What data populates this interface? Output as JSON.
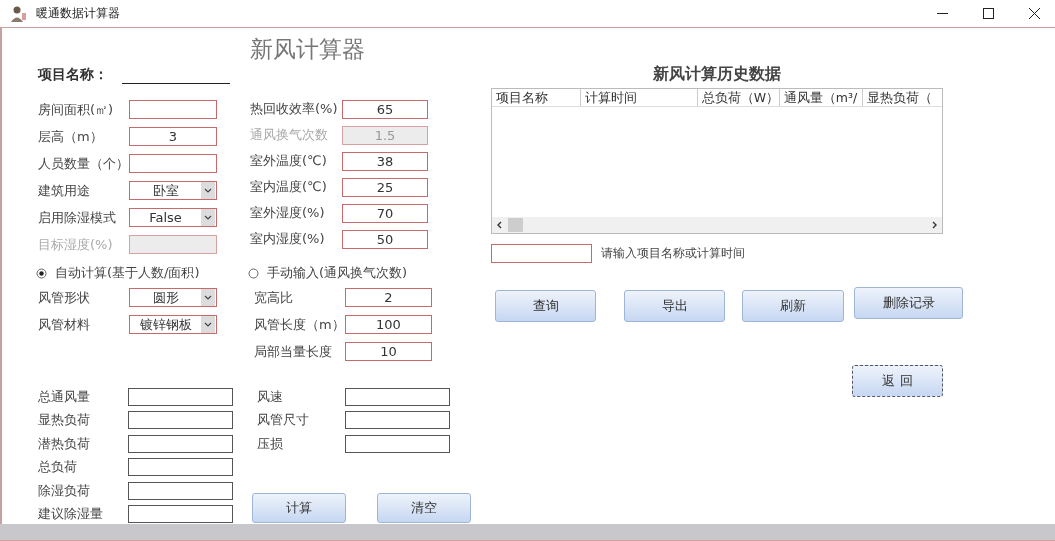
{
  "window": {
    "title": "暖通数据计算器"
  },
  "heading": "新风计算器",
  "project": {
    "label": "项目名称："
  },
  "inputs_left": [
    {
      "label": "房间面积(㎡)",
      "kind": "text",
      "disabled": false
    },
    {
      "label": "层高（m）",
      "kind": "text",
      "disabled": false,
      "value": "3"
    },
    {
      "label": "人员数量（个）",
      "kind": "text",
      "disabled": false
    },
    {
      "label": "建筑用途",
      "kind": "select",
      "disabled": false,
      "value": "卧室"
    },
    {
      "label": "启用除湿模式",
      "kind": "select",
      "disabled": false,
      "value": "False"
    },
    {
      "label": "目标湿度(%)",
      "kind": "text",
      "disabled": true
    }
  ],
  "inputs_right": [
    {
      "label": "热回收效率(%)",
      "kind": "text",
      "disabled": false,
      "value": "65"
    },
    {
      "label": "通风换气次数",
      "kind": "text",
      "disabled": true,
      "value": "1.5"
    },
    {
      "label": "室外温度(℃)",
      "kind": "text",
      "disabled": false,
      "value": "38"
    },
    {
      "label": "室内温度(℃)",
      "kind": "text",
      "disabled": false,
      "value": "25"
    },
    {
      "label": "室外湿度(%)",
      "kind": "text",
      "disabled": false,
      "value": "70"
    },
    {
      "label": "室内湿度(%)",
      "kind": "text",
      "disabled": false,
      "value": "50"
    }
  ],
  "modes": [
    {
      "label": "自动计算(基于人数/面积)",
      "selected": true
    },
    {
      "label": "手动输入(通风换气次数)",
      "selected": false
    }
  ],
  "duct_left": [
    {
      "label": "风管形状",
      "kind": "select",
      "disabled": false,
      "value": "圆形"
    },
    {
      "label": "风管材料",
      "kind": "select",
      "disabled": false,
      "value": "镀锌钢板"
    }
  ],
  "duct_right": [
    {
      "label": "宽高比",
      "kind": "text",
      "disabled": false,
      "value": "2"
    },
    {
      "label": "风管长度（m）",
      "kind": "text",
      "disabled": false,
      "value": "100"
    },
    {
      "label": "局部当量长度",
      "kind": "text",
      "disabled": false,
      "value": "10"
    }
  ],
  "results_left": [
    "总通风量",
    "显热负荷",
    "潜热负荷",
    "总负荷",
    "除湿负荷",
    "建议除湿量"
  ],
  "results_right": [
    "风速",
    "风管尺寸",
    "压损"
  ],
  "actions": [
    "计算",
    "清空"
  ],
  "history": {
    "title": "新风计算历史数据",
    "columns": [
      "项目名称",
      "计算时间",
      "总负荷（W）",
      "通风量（m³/",
      "显热负荷（"
    ],
    "search_hint": "请输入项目名称或计算时间",
    "buttons": [
      "查询",
      "导出",
      "刷新",
      "删除记录"
    ],
    "back": "返 回"
  }
}
